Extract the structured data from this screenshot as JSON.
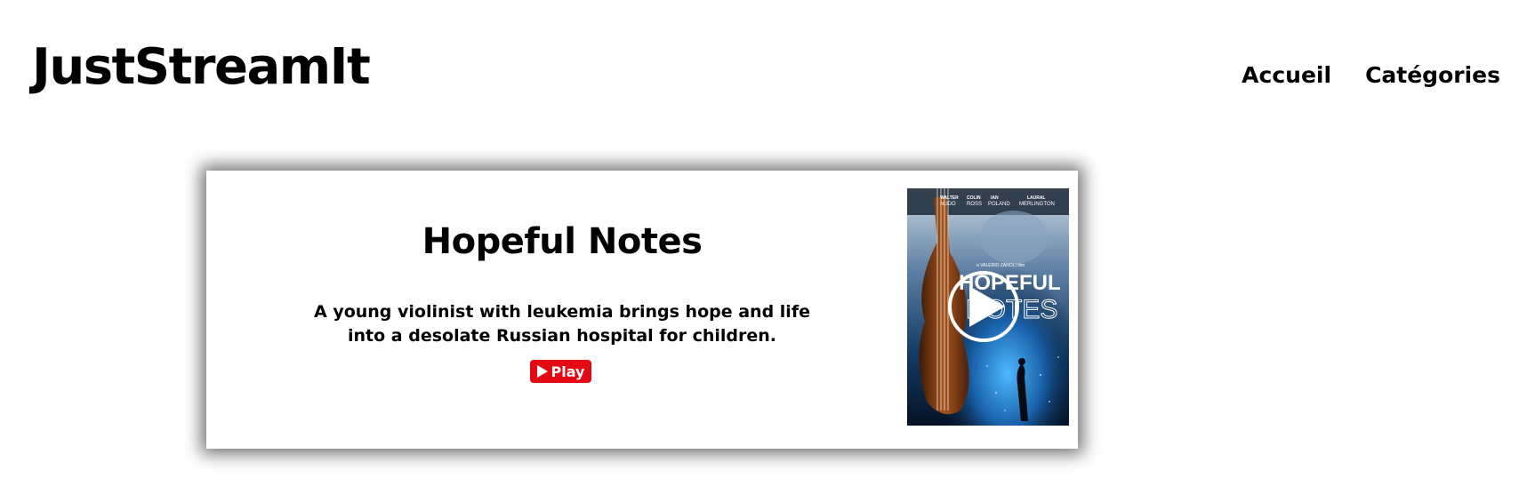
{
  "header": {
    "brand": "JustStreamIt",
    "nav": [
      {
        "label": "Accueil"
      },
      {
        "label": "Catégories"
      }
    ]
  },
  "hero": {
    "title": "Hopeful Notes",
    "description": "A young violinist with leukemia brings hope and life into a desolate Russian hospital for children.",
    "play_label": "Play",
    "play_color": "#e50914",
    "poster": {
      "cast": [
        "WALTER",
        "NUDO",
        "COLIN",
        "ROSS",
        "IAN",
        "POLAND",
        "LAURAL",
        "MERLINGTON"
      ],
      "director_line": "a VALERIO ZANOLI film",
      "title_line1": "HOPEFUL",
      "title_line2": "NOTES",
      "play_icon": "play-circle-icon"
    }
  }
}
